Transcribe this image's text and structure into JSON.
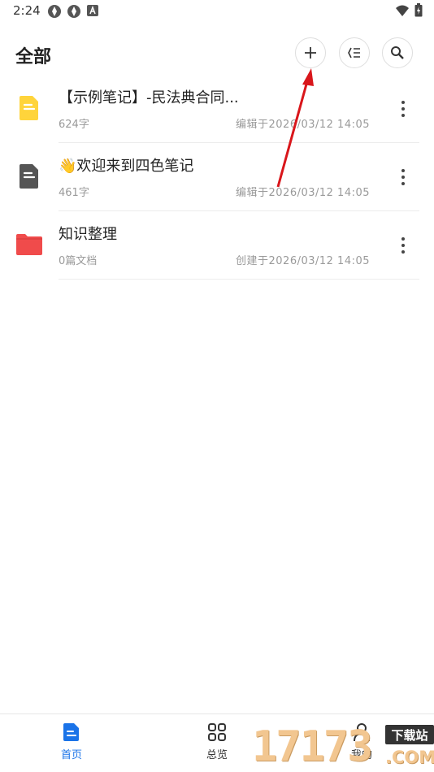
{
  "status_bar": {
    "time": "2:24"
  },
  "header": {
    "title": "全部",
    "add_icon": "plus-icon",
    "sort_icon": "list-sort-icon",
    "search_icon": "search-icon"
  },
  "list": [
    {
      "title": "【示例笔记】-民法典合同...",
      "meta": "624字",
      "time": "编辑于2026/03/12 14:05",
      "icon": "yellow-note-icon",
      "color": "#FFD43B"
    },
    {
      "title": "👋欢迎来到四色笔记",
      "meta": "461字",
      "time": "编辑于2026/03/12 14:05",
      "icon": "dark-note-icon",
      "color": "#555555"
    },
    {
      "title": "知识整理",
      "meta": "0篇文档",
      "time": "创建于2026/03/12 14:05",
      "icon": "red-folder-icon",
      "color": "#F04B4B"
    }
  ],
  "bottom_nav": {
    "home": "首页",
    "overview": "总览",
    "me": "我的"
  },
  "watermark": {
    "digits": "17173",
    "badge": "下载站",
    "suffix": ".COM"
  },
  "colors": {
    "accent": "#1A73E8",
    "annotation_arrow": "#D9161B"
  }
}
